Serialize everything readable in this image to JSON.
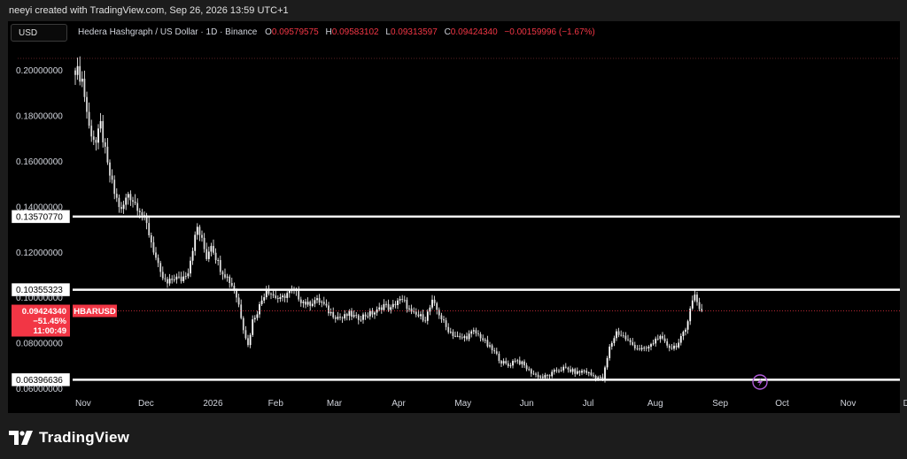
{
  "header": {
    "credit": "neeyi created with TradingView.com, Sep 26, 2026 13:59 UTC+1"
  },
  "toolbar": {
    "currency": "USD"
  },
  "legend": {
    "symbol": "Hedera Hashgraph / US Dollar · 1D · Binance",
    "open_key": "O",
    "open": "0.09579575",
    "high_key": "H",
    "high": "0.09583102",
    "low_key": "L",
    "low": "0.09313597",
    "close_key": "C",
    "close": "0.09424340",
    "change": "−0.00159996 (−1.67%)"
  },
  "colors": {
    "background": "#000000",
    "frame": "#1c1c1c",
    "candle": "#ffffff",
    "level_line": "#ffffff",
    "price_badge": "#f23645",
    "negative_text": "#f23645"
  },
  "footer": {
    "brand": "TradingView"
  },
  "replay_icon": "lightning-circle-icon",
  "chart_data": {
    "type": "candlestick",
    "symbol": "HBARUSD",
    "interval": "1D",
    "ylim": [
      0.0575,
      0.2115
    ],
    "y_ticks": [
      "0.20000000",
      "0.18000000",
      "0.16000000",
      "0.14000000",
      "0.12000000",
      "0.10000000",
      "0.08000000",
      "0.06000000"
    ],
    "y_tick_values": [
      0.2,
      0.18,
      0.16,
      0.14,
      0.12,
      0.1,
      0.08,
      0.06
    ],
    "x_ticks": [
      "Nov",
      "Dec",
      "2026",
      "Feb",
      "Mar",
      "Apr",
      "May",
      "Jun",
      "Jul",
      "Aug",
      "Sep",
      "Oct",
      "Nov",
      "Dec"
    ],
    "horizontal_levels": [
      {
        "label": "0.13570770",
        "value": 0.1357077
      },
      {
        "label": "0.10355323",
        "value": 0.10355323
      },
      {
        "label": "0.06396636",
        "value": 0.06396636
      }
    ],
    "current_price": {
      "value": 0.0942434,
      "price_label": "0.09424340",
      "change_label": "−51.45%",
      "countdown": "11:00:49",
      "symbol_tag": "HBARUSD"
    },
    "close_path": [
      [
        0,
        0.201
      ],
      [
        3,
        0.196
      ],
      [
        6,
        0.175
      ],
      [
        9,
        0.168
      ],
      [
        11,
        0.176
      ],
      [
        14,
        0.158
      ],
      [
        17,
        0.146
      ],
      [
        20,
        0.138
      ],
      [
        23,
        0.146
      ],
      [
        25,
        0.143
      ],
      [
        28,
        0.139
      ],
      [
        31,
        0.132
      ],
      [
        34,
        0.121
      ],
      [
        37,
        0.11
      ],
      [
        40,
        0.106
      ],
      [
        43,
        0.109
      ],
      [
        46,
        0.108
      ],
      [
        49,
        0.112
      ],
      [
        51,
        0.122
      ],
      [
        53,
        0.131
      ],
      [
        55,
        0.125
      ],
      [
        57,
        0.118
      ],
      [
        59,
        0.124
      ],
      [
        61,
        0.118
      ],
      [
        63,
        0.113
      ],
      [
        66,
        0.109
      ],
      [
        69,
        0.104
      ],
      [
        71,
        0.097
      ],
      [
        73,
        0.087
      ],
      [
        75,
        0.079
      ],
      [
        77,
        0.09
      ],
      [
        79,
        0.094
      ],
      [
        81,
        0.099
      ],
      [
        83,
        0.104
      ],
      [
        86,
        0.101
      ],
      [
        89,
        0.099
      ],
      [
        92,
        0.102
      ],
      [
        95,
        0.103
      ],
      [
        98,
        0.099
      ],
      [
        101,
        0.097
      ],
      [
        104,
        0.099
      ],
      [
        107,
        0.098
      ],
      [
        110,
        0.094
      ],
      [
        113,
        0.092
      ],
      [
        116,
        0.091
      ],
      [
        119,
        0.093
      ],
      [
        122,
        0.091
      ],
      [
        125,
        0.092
      ],
      [
        128,
        0.093
      ],
      [
        131,
        0.094
      ],
      [
        134,
        0.097
      ],
      [
        137,
        0.095
      ],
      [
        140,
        0.099
      ],
      [
        143,
        0.098
      ],
      [
        146,
        0.093
      ],
      [
        149,
        0.092
      ],
      [
        152,
        0.091
      ],
      [
        155,
        0.098
      ],
      [
        158,
        0.093
      ],
      [
        161,
        0.087
      ],
      [
        164,
        0.084
      ],
      [
        167,
        0.082
      ],
      [
        170,
        0.083
      ],
      [
        173,
        0.085
      ],
      [
        176,
        0.083
      ],
      [
        179,
        0.079
      ],
      [
        182,
        0.076
      ],
      [
        185,
        0.072
      ],
      [
        188,
        0.07
      ],
      [
        191,
        0.073
      ],
      [
        194,
        0.071
      ],
      [
        197,
        0.068
      ],
      [
        200,
        0.066
      ],
      [
        203,
        0.065
      ],
      [
        206,
        0.066
      ],
      [
        209,
        0.068
      ],
      [
        212,
        0.069
      ],
      [
        215,
        0.068
      ],
      [
        218,
        0.067
      ],
      [
        221,
        0.068
      ],
      [
        224,
        0.066
      ],
      [
        227,
        0.065
      ],
      [
        229,
        0.064
      ],
      [
        232,
        0.078
      ],
      [
        235,
        0.085
      ],
      [
        238,
        0.083
      ],
      [
        241,
        0.08
      ],
      [
        244,
        0.078
      ],
      [
        247,
        0.077
      ],
      [
        250,
        0.079
      ],
      [
        253,
        0.083
      ],
      [
        256,
        0.08
      ],
      [
        259,
        0.078
      ],
      [
        262,
        0.08
      ],
      [
        265,
        0.086
      ],
      [
        267,
        0.096
      ],
      [
        269,
        0.101
      ],
      [
        271,
        0.0958
      ],
      [
        272,
        0.0942
      ]
    ]
  }
}
